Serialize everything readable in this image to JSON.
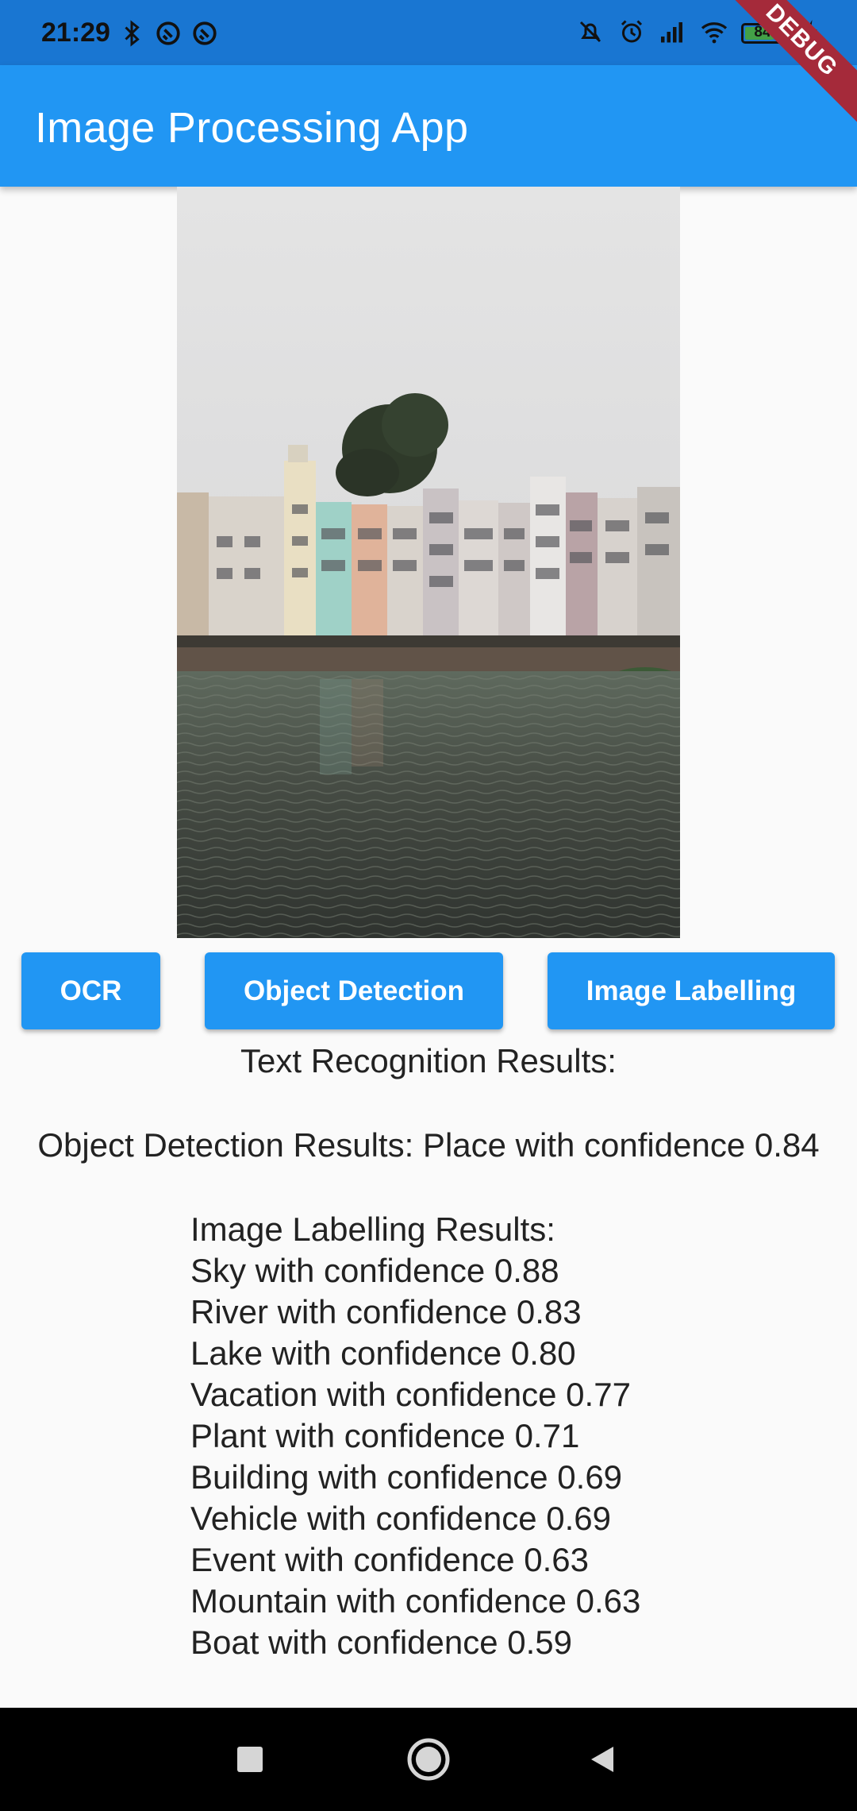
{
  "status_bar": {
    "time": "21:29",
    "battery_level": "84",
    "battery_fraction": 0.84,
    "left_icons": [
      "bluetooth-icon",
      "sync-icon",
      "sync-icon"
    ],
    "right_icons": [
      "mute-icon",
      "alarm-icon",
      "signal-icon",
      "wifi-icon",
      "battery-icon",
      "charging-icon"
    ]
  },
  "debug_banner": "DEBUG",
  "app_bar": {
    "title": "Image Processing App"
  },
  "buttons": {
    "ocr": "OCR",
    "object_detection": "Object Detection",
    "image_labelling": "Image Labelling"
  },
  "results": {
    "ocr": "Text Recognition Results:",
    "object_detection": "Object Detection Results: Place with confidence 0.84",
    "image_labelling_header": "Image Labelling Results:",
    "labels": [
      "Sky with confidence 0.88",
      "River with confidence 0.83",
      "Lake with confidence 0.80",
      "Vacation with confidence 0.77",
      "Plant with confidence 0.71",
      "Building with confidence 0.69",
      "Vehicle with confidence 0.69",
      "Event with confidence 0.63",
      "Mountain with confidence 0.63",
      "Boat with confidence 0.59"
    ]
  },
  "nav_bar": {
    "icons": [
      "recents-icon",
      "home-icon",
      "back-icon"
    ]
  },
  "colors": {
    "primary": "#2196f3",
    "status_bar": "#1976d2",
    "debug": "#a52a3a"
  }
}
